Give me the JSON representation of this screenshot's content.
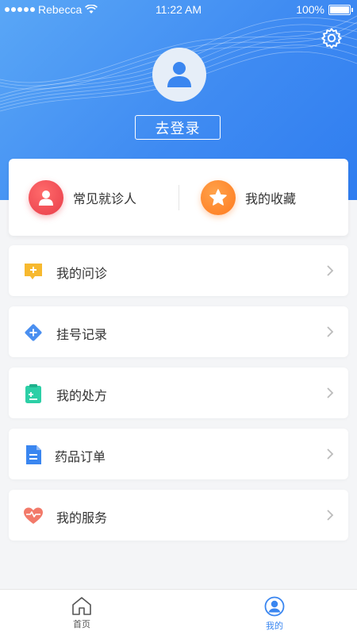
{
  "status_bar": {
    "carrier": "Rebecca",
    "time": "11:22 AM",
    "battery": "100%"
  },
  "header": {
    "login_label": "去登录",
    "avatar_icon": "user-icon",
    "settings_icon": "gear-icon"
  },
  "quick_actions": [
    {
      "label": "常见就诊人",
      "icon": "person-icon",
      "color": "#e83d4a"
    },
    {
      "label": "我的收藏",
      "icon": "star-icon",
      "color": "#ff7a1f"
    }
  ],
  "menu": [
    {
      "label": "我的问诊",
      "icon": "chat-plus-icon",
      "color": "#f7b92f"
    },
    {
      "label": "挂号记录",
      "icon": "diamond-plus-icon",
      "color": "#4a8ff0"
    },
    {
      "label": "我的处方",
      "icon": "clipboard-icon",
      "color": "#2ccfa6"
    },
    {
      "label": "药品订单",
      "icon": "document-icon",
      "color": "#3a86f0"
    },
    {
      "label": "我的服务",
      "icon": "heart-icon",
      "color": "#f27a6a"
    }
  ],
  "tabbar": {
    "tabs": [
      {
        "label": "首页",
        "icon": "home-icon",
        "active": false
      },
      {
        "label": "我的",
        "icon": "profile-icon",
        "active": true
      }
    ],
    "active_color": "#3a86f0"
  }
}
